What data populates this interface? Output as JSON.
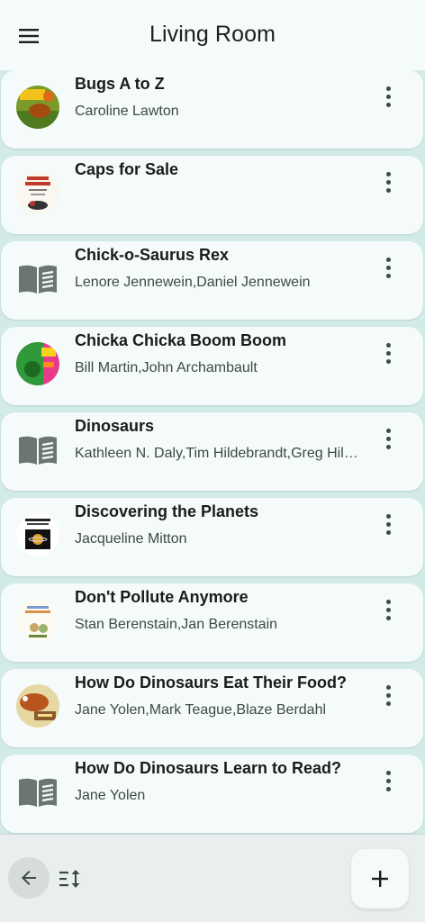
{
  "header": {
    "title": "Living Room",
    "menu_icon": "menu-icon"
  },
  "books": [
    {
      "title": "Bugs A to Z",
      "author": "Caroline Lawton",
      "cover": "bugs-cover"
    },
    {
      "title": "Caps for Sale",
      "author": "",
      "cover": "caps-cover"
    },
    {
      "title": "Chick-o-Saurus Rex",
      "author": "Lenore Jennewein,Daniel Jennewein",
      "cover": "book-icon"
    },
    {
      "title": "Chicka Chicka Boom Boom",
      "author": "Bill Martin,John Archambault",
      "cover": "chicka-cover"
    },
    {
      "title": "Dinosaurs",
      "author": "Kathleen N. Daly,Tim Hildebrandt,Greg Hild...",
      "cover": "book-icon"
    },
    {
      "title": "Discovering the Planets",
      "author": "Jacqueline Mitton",
      "cover": "planets-cover"
    },
    {
      "title": "Don't Pollute Anymore",
      "author": "Stan Berenstain,Jan Berenstain",
      "cover": "pollute-cover"
    },
    {
      "title": "How Do Dinosaurs Eat Their Food?",
      "author": "Jane Yolen,Mark Teague,Blaze Berdahl",
      "cover": "dinosaurs-food-cover"
    },
    {
      "title": "How Do Dinosaurs Learn to Read?",
      "author": "Jane Yolen",
      "cover": "book-icon"
    }
  ],
  "bottom": {
    "back_icon": "arrow-back-icon",
    "sort_icon": "sort-icon",
    "add_icon": "plus-icon"
  },
  "colors": {
    "background": "#d3ebe7",
    "surface": "#f4fbfa",
    "text": "#161d1c",
    "secondary": "#3f4947"
  }
}
